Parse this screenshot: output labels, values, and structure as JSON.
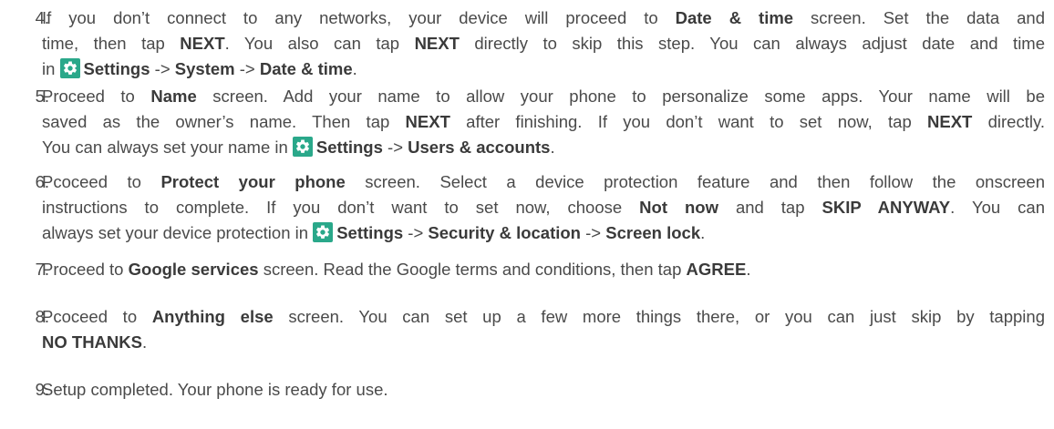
{
  "steps": [
    {
      "num": "4.",
      "lines": [
        [
          {
            "t": "If you don’t connect to any networks, your device will proceed to "
          },
          {
            "t": "Date & time",
            "b": true
          },
          {
            "t": " screen. Set the data and"
          }
        ],
        [
          {
            "t": "time, then tap "
          },
          {
            "t": "NEXT",
            "b": true
          },
          {
            "t": ". You also can tap "
          },
          {
            "t": "NEXT",
            "b": true
          },
          {
            "t": " directly to skip this step. You can always adjust date and time"
          }
        ],
        [
          {
            "t": "in "
          },
          {
            "icon": "settings-gear-icon"
          },
          {
            "t": "Settings",
            "b": true
          },
          {
            "t": " -> "
          },
          {
            "t": "System",
            "b": true
          },
          {
            "t": " -> "
          },
          {
            "t": "Date & time",
            "b": true
          },
          {
            "t": "."
          }
        ]
      ]
    },
    {
      "num": "5.",
      "lines": [
        [
          {
            "t": "Proceed to "
          },
          {
            "t": "Name",
            "b": true
          },
          {
            "t": " screen. Add your name to allow your phone to personalize some apps. Your name will be"
          }
        ],
        [
          {
            "t": "saved as the owner’s name. Then tap "
          },
          {
            "t": "NEXT",
            "b": true
          },
          {
            "t": " after finishing. If you don’t want to set now, tap "
          },
          {
            "t": "NEXT",
            "b": true
          },
          {
            "t": " directly."
          }
        ],
        [
          {
            "t": "You can always set your name in "
          },
          {
            "icon": "settings-gear-icon"
          },
          {
            "t": "Settings",
            "b": true
          },
          {
            "t": " -> "
          },
          {
            "t": "Users & accounts",
            "b": true
          },
          {
            "t": "."
          }
        ]
      ]
    },
    {
      "num": "6.",
      "lines": [
        [
          {
            "t": "Pcoceed to "
          },
          {
            "t": "Protect your phone",
            "b": true
          },
          {
            "t": " screen. Select a device protection feature and then follow the onscreen"
          }
        ],
        [
          {
            "t": "instructions to complete. If you don’t want to set now, choose "
          },
          {
            "t": "Not now",
            "b": true
          },
          {
            "t": " and tap "
          },
          {
            "t": "SKIP ANYWAY",
            "b": true
          },
          {
            "t": ". You can"
          }
        ],
        [
          {
            "t": "always set your device protection in "
          },
          {
            "icon": "settings-gear-icon"
          },
          {
            "t": "Settings",
            "b": true
          },
          {
            "t": " -> "
          },
          {
            "t": "Security & location",
            "b": true
          },
          {
            "t": " -> "
          },
          {
            "t": "Screen lock",
            "b": true
          },
          {
            "t": "."
          }
        ]
      ]
    },
    {
      "num": "7.",
      "lines": [
        [
          {
            "t": "Proceed to "
          },
          {
            "t": "Google services",
            "b": true
          },
          {
            "t": " screen. Read the Google terms and conditions, then tap "
          },
          {
            "t": "AGREE",
            "b": true
          },
          {
            "t": "."
          }
        ]
      ]
    },
    {
      "num": "8.",
      "lines": [
        [
          {
            "t": "Pcoceed to "
          },
          {
            "t": "Anything else",
            "b": true
          },
          {
            "t": " screen. You can set up a few more things there, or you can just skip by tapping"
          }
        ],
        [
          {
            "t": "NO THANKS",
            "b": true
          },
          {
            "t": "."
          }
        ]
      ]
    },
    {
      "num": "9.",
      "lines": [
        [
          {
            "t": "Setup completed. Your phone is ready for use."
          }
        ]
      ]
    }
  ],
  "colors": {
    "text": "#4a4a4a",
    "settings_icon_bg": "#2aa88a"
  }
}
